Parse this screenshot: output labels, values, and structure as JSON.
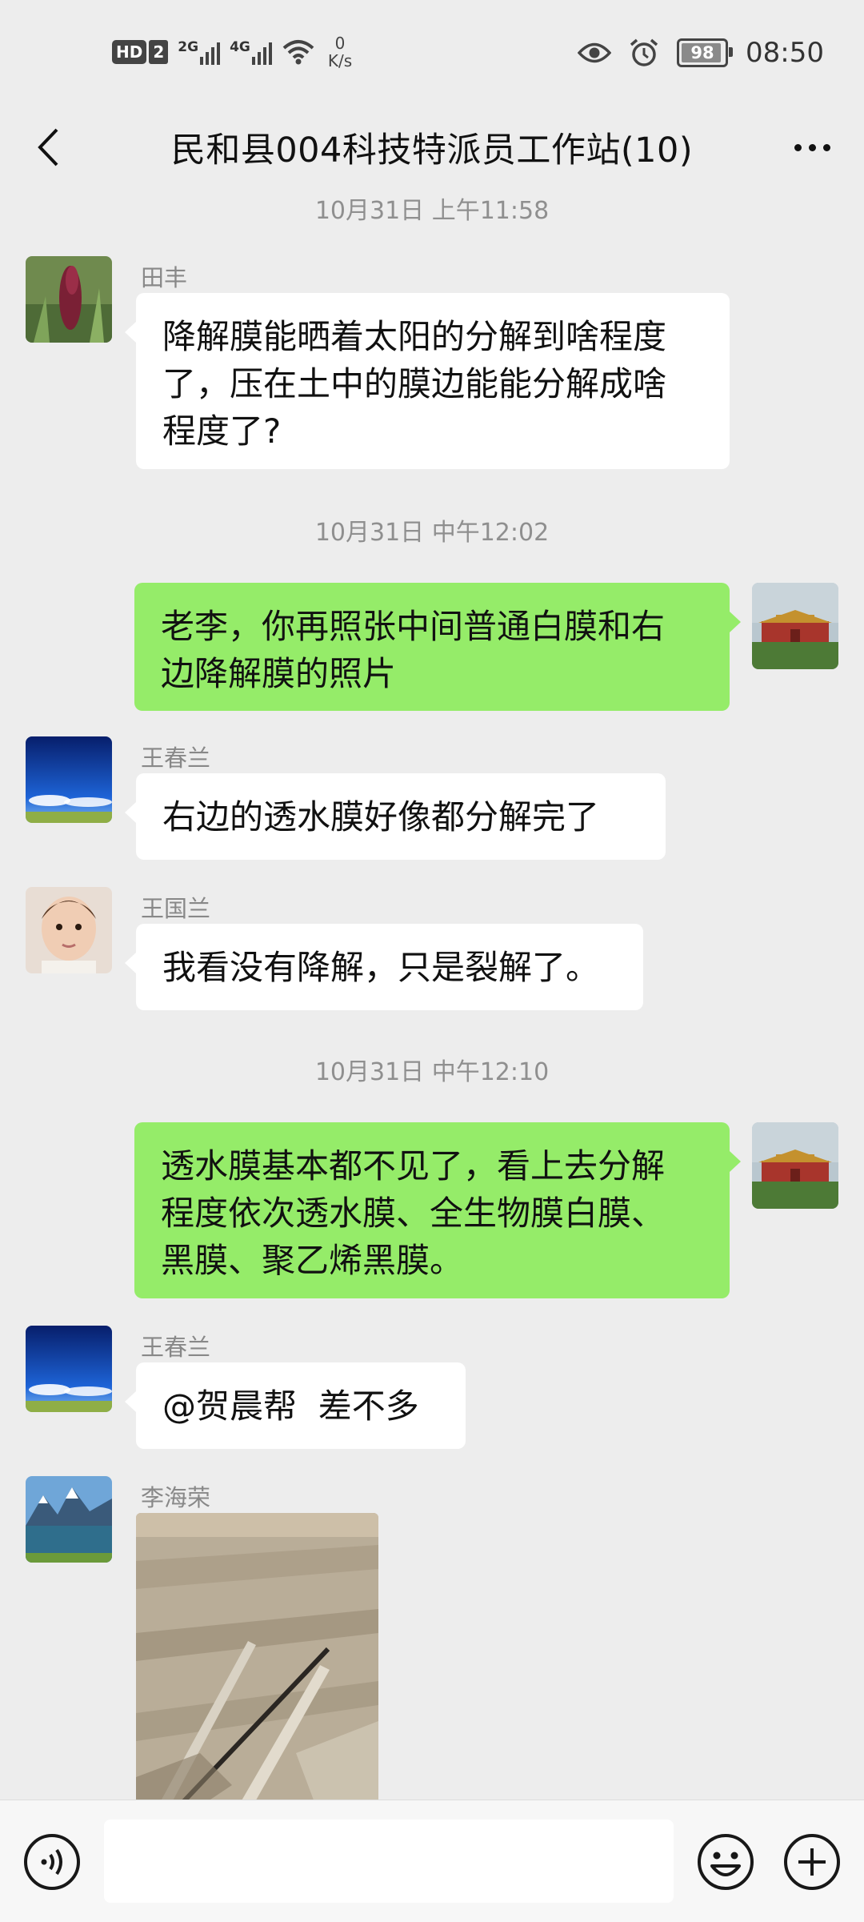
{
  "status_bar": {
    "hd": "HD",
    "sim": "2",
    "net1": "2G",
    "net2": "4G",
    "speed_value": "0",
    "speed_unit": "K/s",
    "battery": "98",
    "time": "08:50"
  },
  "header": {
    "title": "民和县004科技特派员工作站(10)"
  },
  "messages": {
    "ts1": "10月31日 上午11:58",
    "m1_sender": "田丰",
    "m1_text": "降解膜能晒着太阳的分解到啥程度\n了，压在土中的膜边能能分解成啥\n程度了?",
    "ts2": "10月31日 中午12:02",
    "m2_text": "老李，你再照张中间普通白膜和右\n边降解膜的照片",
    "m3_sender": "王春兰",
    "m3_text": "右边的透水膜好像都分解完了",
    "m4_sender": "王国兰",
    "m4_text": "我看没有降解，只是裂解了。",
    "ts3": "10月31日 中午12:10",
    "m5_text": "透水膜基本都不见了，看上去分解\n程度依次透水膜、全生物膜白膜、\n黑膜、聚乙烯黑膜。",
    "m6_sender": "王春兰",
    "m6_text": "@贺晨帮  差不多",
    "m7_sender": "李海荣"
  },
  "input": {
    "placeholder": ""
  },
  "colors": {
    "background": "#ededed",
    "outgoing_bubble": "#95ec69",
    "incoming_bubble": "#ffffff"
  }
}
